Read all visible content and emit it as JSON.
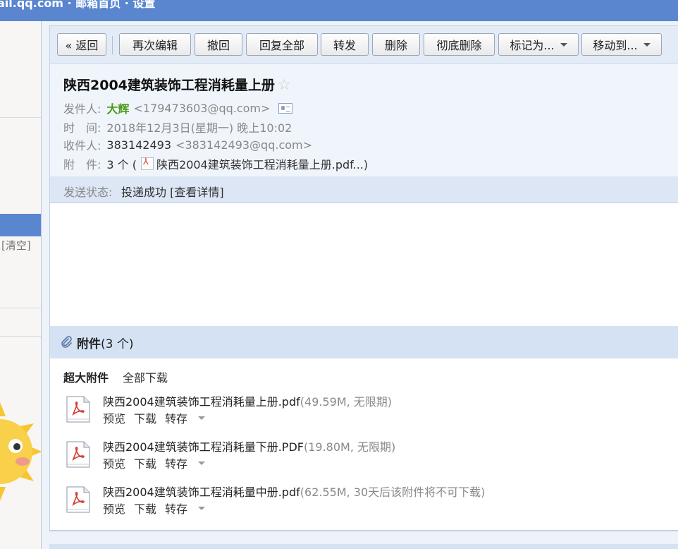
{
  "topbar": {
    "text": "ail.qq.com · 邮箱首页 · 设置"
  },
  "sidebar": {
    "clear_label": "[清空]"
  },
  "toolbar": {
    "back": "« 返回",
    "edit_again": "再次编辑",
    "recall": "撤回",
    "reply_all": "回复全部",
    "forward": "转发",
    "delete": "删除",
    "delete_permanently": "彻底删除",
    "mark_as": "标记为...",
    "move_to": "移动到..."
  },
  "email": {
    "subject": "陕西2004建筑装饰工程消耗量上册",
    "sender_label": "发件人:",
    "sender_name": "大辉",
    "sender_email": "<179473603@qq.com>",
    "time_label": "时　间:",
    "time": "2018年12月3日(星期一) 晚上10:02",
    "recipient_label": "收件人:",
    "recipient_name": "383142493",
    "recipient_email": "<383142493@qq.com>",
    "attach_label": "附　件:",
    "attach_summary_prefix": "3 个 (",
    "attach_summary_file": "陕西2004建筑装饰工程消耗量上册.pdf...)",
    "status_label": "发送状态:",
    "status_value": "投递成功 [查看详情]"
  },
  "attachments": {
    "title": "附件",
    "count": "(3 个)",
    "big_label": "超大附件",
    "download_all": "全部下载",
    "preview": "预览",
    "download": "下载",
    "save_to": "转存",
    "files": [
      {
        "name": "陕西2004建筑装饰工程消耗量上册.pdf",
        "info": "(49.59M, 无限期)"
      },
      {
        "name": "陕西2004建筑装饰工程消耗量下册.PDF",
        "info": "(19.80M, 无限期)"
      },
      {
        "name": "陕西2004建筑装饰工程消耗量中册.pdf",
        "info": "(62.55M, 30天后该附件将不可下载)"
      }
    ]
  },
  "icons": {
    "star": "star-icon",
    "contact_card": "contact-card-icon",
    "paperclip": "paperclip-icon",
    "pdf": "pdf-file-icon"
  },
  "colors": {
    "accent_blue": "#5a86d0",
    "sender_green": "#4a9a1a",
    "pdf_red": "#d23a2a"
  }
}
